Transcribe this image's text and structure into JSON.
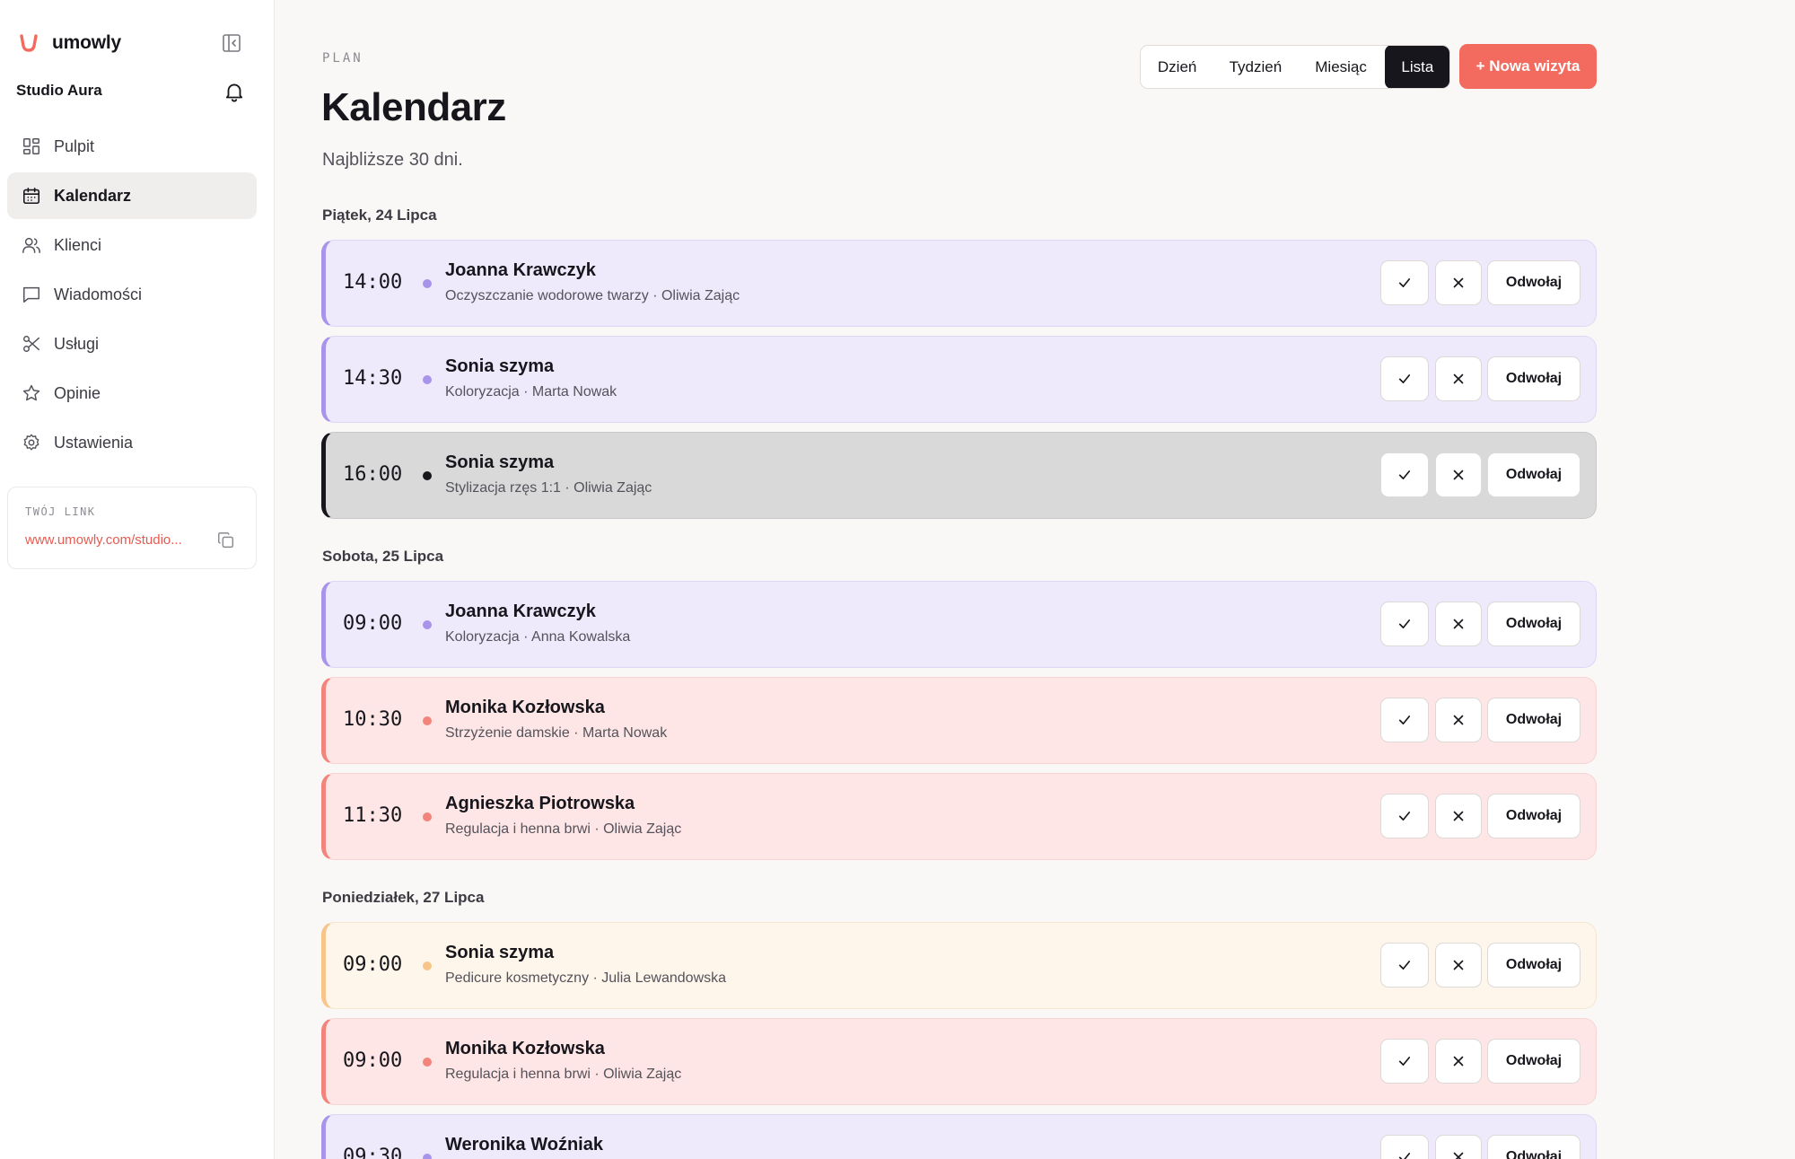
{
  "app": {
    "brand": "umowly",
    "studio": "Studio Aura",
    "brand_color": "#f26b5e"
  },
  "sidebar": {
    "items": [
      {
        "label": "Pulpit",
        "icon": "dashboard-icon"
      },
      {
        "label": "Kalendarz",
        "icon": "calendar-icon",
        "active": true
      },
      {
        "label": "Klienci",
        "icon": "users-icon"
      },
      {
        "label": "Wiadomości",
        "icon": "message-icon"
      },
      {
        "label": "Usługi",
        "icon": "scissors-icon"
      },
      {
        "label": "Opinie",
        "icon": "star-icon"
      },
      {
        "label": "Ustawienia",
        "icon": "gear-icon"
      }
    ],
    "link_label": "TWÓJ LINK",
    "link_url": "www.umowly.com/studio..."
  },
  "header": {
    "eyebrow": "PLAN",
    "title": "Kalendarz",
    "subtitle": "Najbliższe 30 dni.",
    "views": [
      "Dzień",
      "Tydzień",
      "Miesiąc",
      "Lista"
    ],
    "active_view": "Lista",
    "new_visit_label": "+ Nowa wizyta"
  },
  "action_labels": {
    "cancel": "Odwołaj"
  },
  "days": [
    {
      "label": "Piątek, 24 Lipca",
      "appointments": [
        {
          "time": "14:00",
          "client": "Joanna Krawczyk",
          "meta": "Oczyszczanie wodorowe twarzy · Oliwia Zając",
          "color": "violet"
        },
        {
          "time": "14:30",
          "client": "Sonia szyma",
          "meta": "Koloryzacja · Marta Nowak",
          "color": "violet"
        },
        {
          "time": "16:00",
          "client": "Sonia szyma",
          "meta": "Stylizacja rzęs 1:1 · Oliwia Zając",
          "color": "dark"
        }
      ]
    },
    {
      "label": "Sobota, 25 Lipca",
      "appointments": [
        {
          "time": "09:00",
          "client": "Joanna Krawczyk",
          "meta": "Koloryzacja · Anna Kowalska",
          "color": "violet"
        },
        {
          "time": "10:30",
          "client": "Monika Kozłowska",
          "meta": "Strzyżenie damskie · Marta Nowak",
          "color": "red"
        },
        {
          "time": "11:30",
          "client": "Agnieszka Piotrowska",
          "meta": "Regulacja i henna brwi · Oliwia Zając",
          "color": "red"
        }
      ]
    },
    {
      "label": "Poniedziałek, 27 Lipca",
      "appointments": [
        {
          "time": "09:00",
          "client": "Sonia szyma",
          "meta": "Pedicure kosmetyczny · Julia Lewandowska",
          "color": "peach"
        },
        {
          "time": "09:00",
          "client": "Monika Kozłowska",
          "meta": "Regulacja i henna brwi · Oliwia Zając",
          "color": "red"
        },
        {
          "time": "09:30",
          "client": "Weronika Woźniak",
          "meta": "",
          "color": "violet"
        }
      ]
    }
  ],
  "colors": {
    "violet": "#a894ea",
    "red": "#f2847b",
    "peach": "#f7c58a",
    "dark": "#17161c"
  }
}
